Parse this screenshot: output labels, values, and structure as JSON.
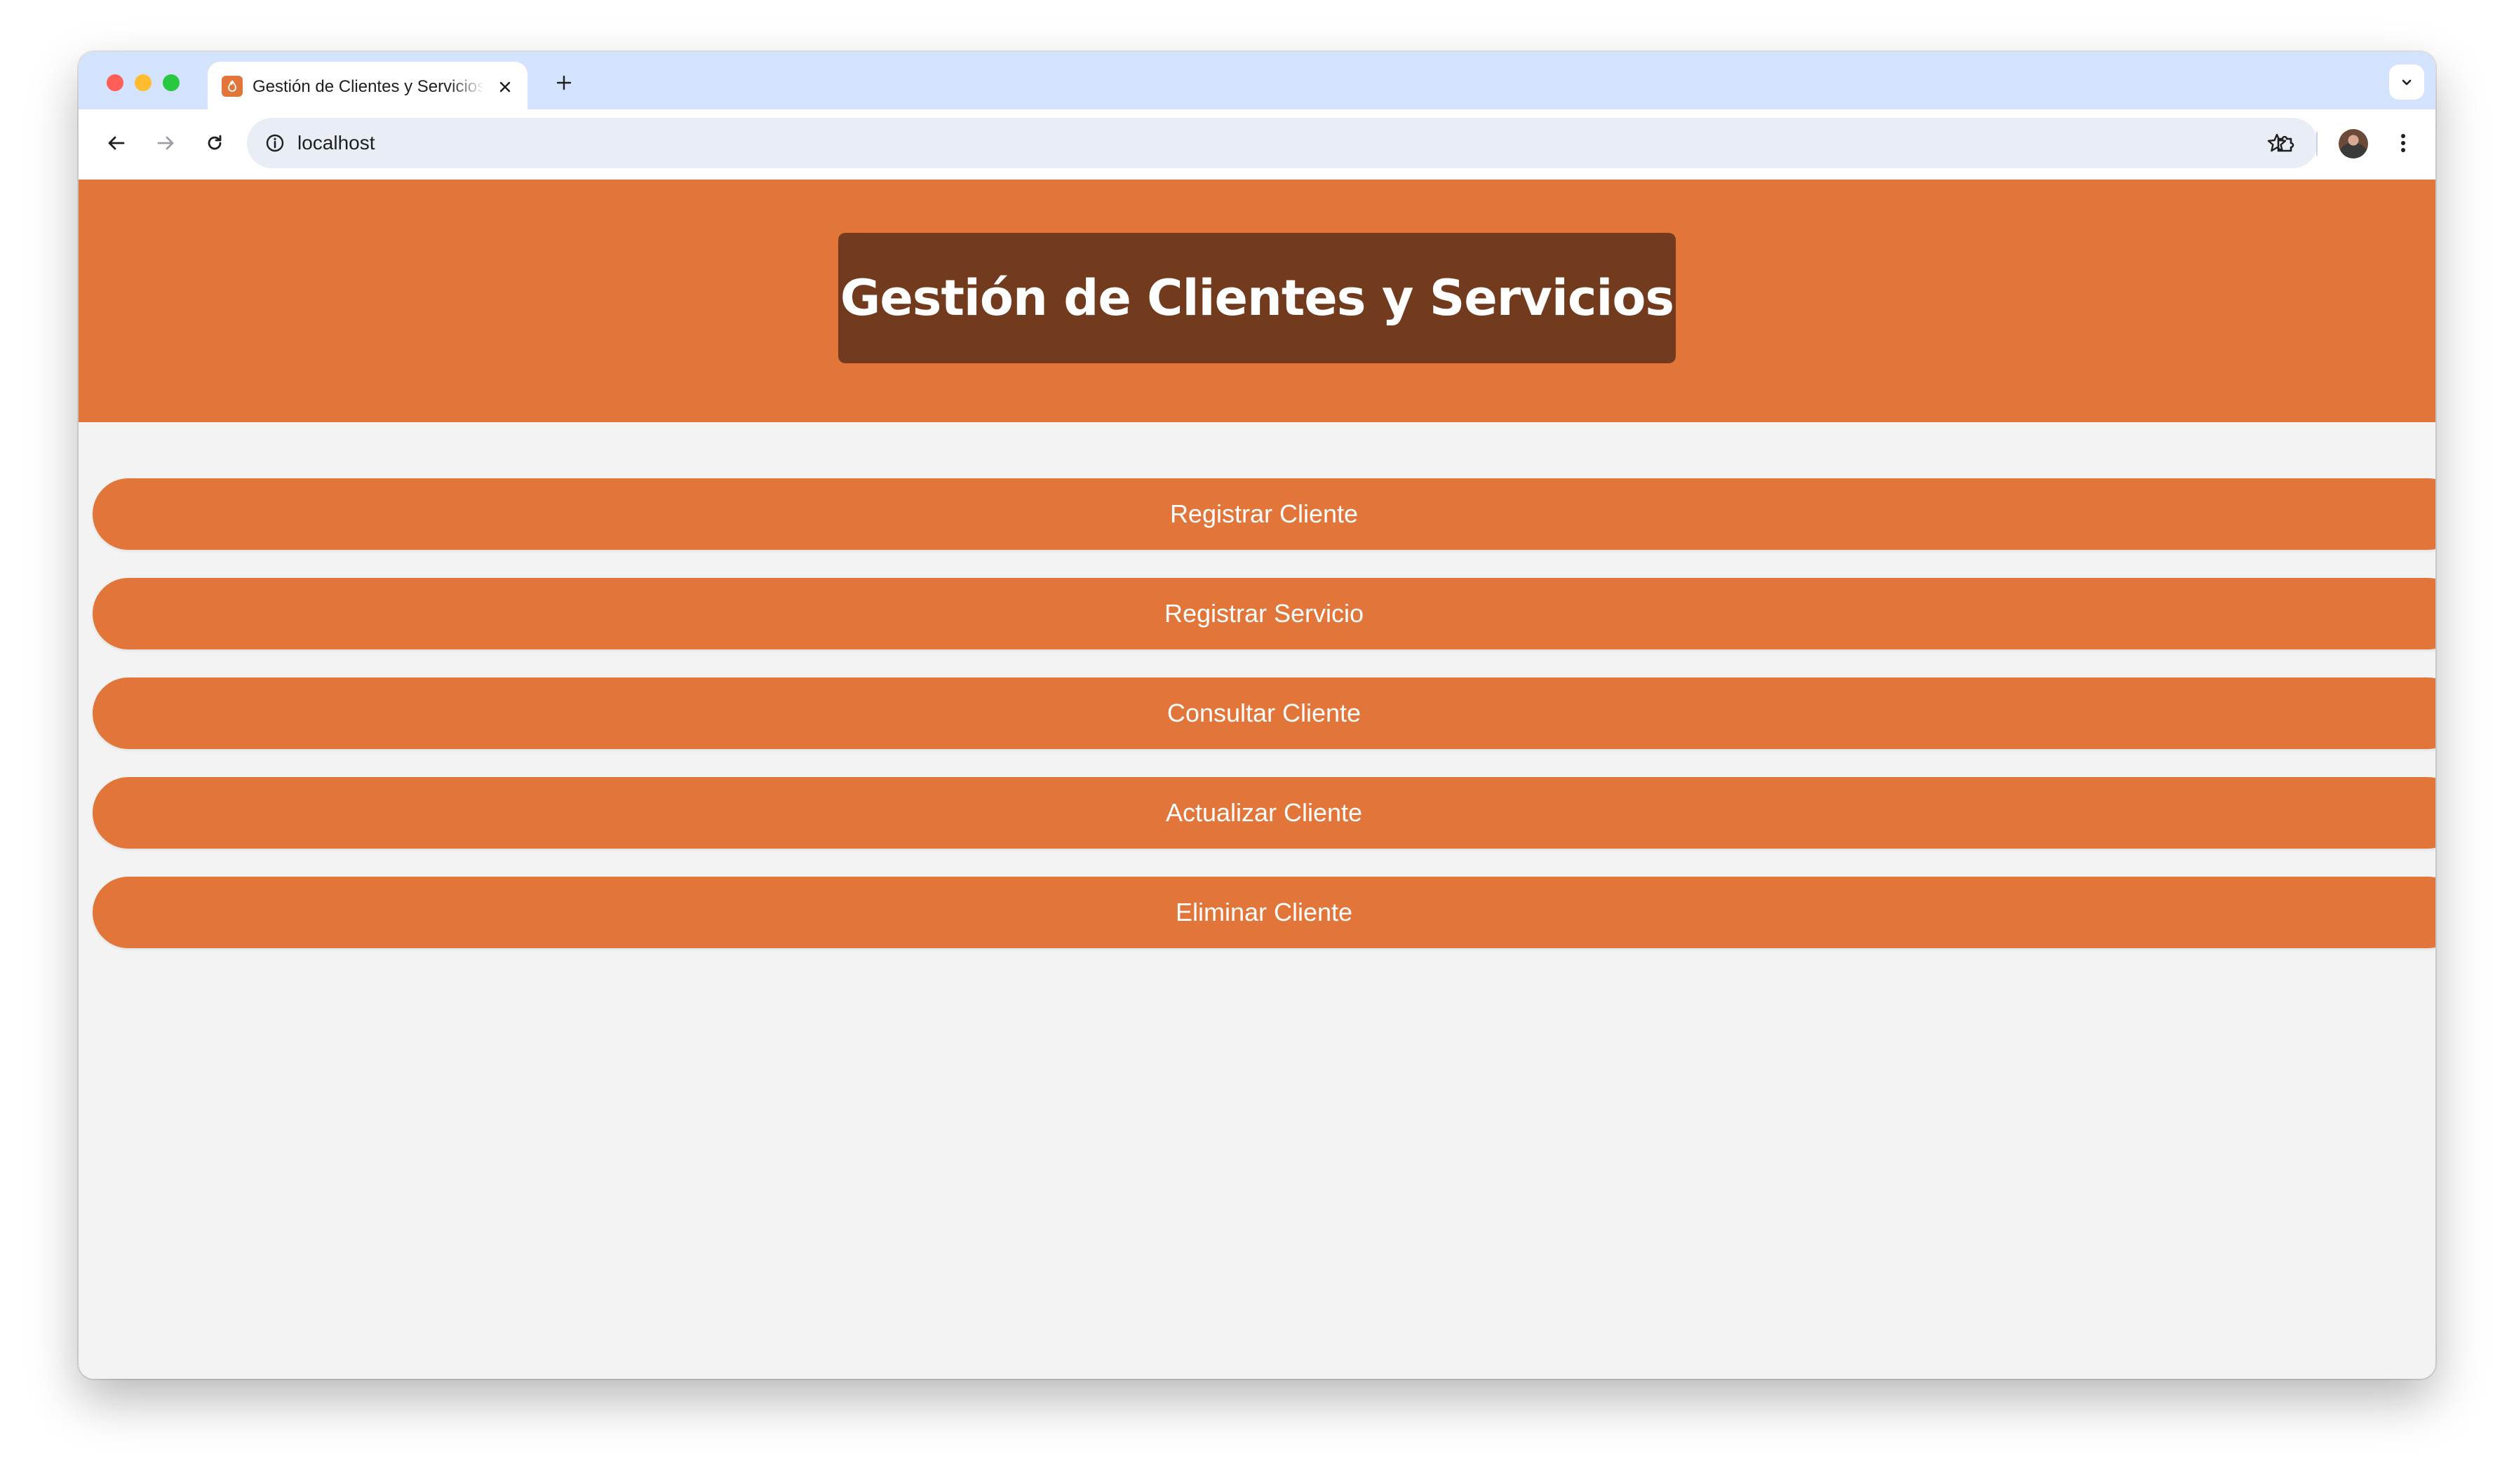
{
  "browser": {
    "tab": {
      "title": "Gestión de Clientes y Servicios",
      "favicon": "flame-icon"
    },
    "address_bar": {
      "url": "localhost"
    }
  },
  "page": {
    "header": {
      "title": "Gestión de Clientes y Servicios"
    },
    "menu": [
      {
        "label": "Registrar Cliente"
      },
      {
        "label": "Registrar Servicio"
      },
      {
        "label": "Consultar Cliente"
      },
      {
        "label": "Actualizar Cliente"
      },
      {
        "label": "Eliminar Cliente"
      }
    ]
  },
  "colors": {
    "accent": "#e2763a",
    "title_box": "#733b1e",
    "background": "#f3f3f3",
    "tabstrip": "#d3e3fd"
  }
}
